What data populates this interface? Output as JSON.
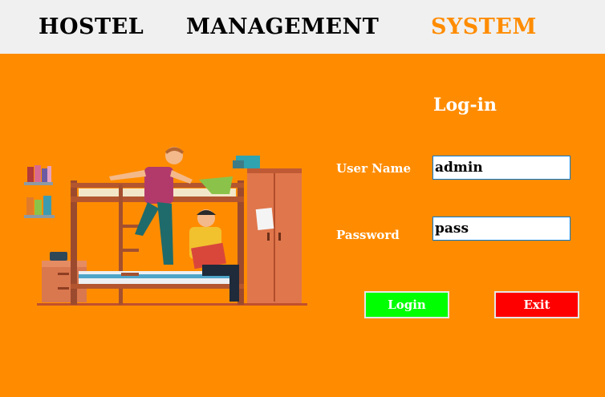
{
  "header": {
    "word1": "HOSTEL",
    "word2": "MANAGEMENT",
    "word3": "SYSTEM"
  },
  "login": {
    "title": "Log-in",
    "username_label": "User Name",
    "username_value": "admin",
    "password_label": "Password",
    "password_value": "pass",
    "login_button": "Login",
    "exit_button": "Exit"
  },
  "colors": {
    "background": "#FF8C00",
    "header_bg": "#F0F0F0",
    "accent": "#FF8C00",
    "login_button": "#00FF00",
    "exit_button": "#FF0000"
  },
  "illustration": {
    "icon": "hostel-students-illustration"
  }
}
